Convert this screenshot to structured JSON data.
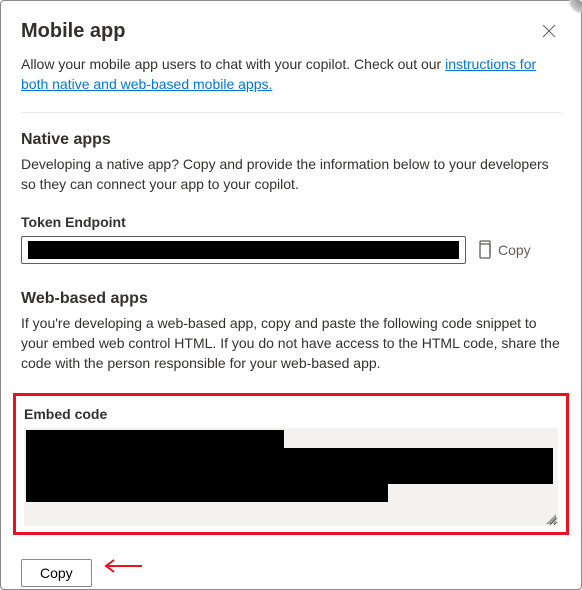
{
  "header": {
    "title": "Mobile app"
  },
  "intro": {
    "prefix": "Allow your mobile app users to chat with your copilot. Check out our ",
    "link_text": "instructions for both native and web-based mobile apps."
  },
  "native": {
    "title": "Native apps",
    "desc": "Developing a native app? Copy and provide the information below to your developers so they can connect your app to your copilot.",
    "token_label": "Token Endpoint",
    "token_value": "████████████████████████████████████████████",
    "copy_label": "Copy"
  },
  "web": {
    "title": "Web-based apps",
    "desc": "If you're developing a web-based app, copy and paste the following code snippet to your embed web control HTML. If you do not have access to the HTML code, share the code with the person responsible for your web-based app.",
    "embed_label": "Embed code",
    "embed_value": "████████████████████████████████████████████████████████████████████████████████████",
    "copy_button": "Copy"
  }
}
